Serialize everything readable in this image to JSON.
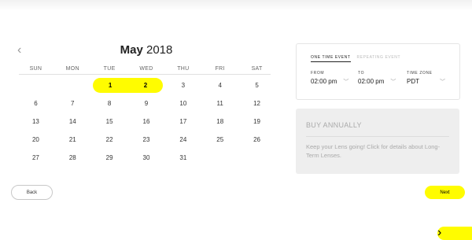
{
  "calendar": {
    "month": "May",
    "year": "2018",
    "prev_symbol": "‹",
    "next_symbol": "›",
    "days_of_week": [
      "SUN",
      "MON",
      "TUE",
      "WED",
      "THU",
      "FRI",
      "SAT"
    ],
    "weeks": [
      [
        "",
        "",
        "1",
        "2",
        "3",
        "4",
        "5"
      ],
      [
        "6",
        "7",
        "8",
        "9",
        "10",
        "11",
        "12"
      ],
      [
        "13",
        "14",
        "15",
        "16",
        "17",
        "18",
        "19"
      ],
      [
        "20",
        "21",
        "22",
        "23",
        "24",
        "25",
        "26"
      ],
      [
        "27",
        "28",
        "29",
        "30",
        "31",
        "",
        ""
      ]
    ],
    "selected_days": [
      "1",
      "2"
    ],
    "highlight_color": "#fffc00"
  },
  "event_panel": {
    "tabs": [
      {
        "label": "ONE TIME EVENT",
        "active": true
      },
      {
        "label": "REPEATING EVENT",
        "active": false
      }
    ],
    "from": {
      "label": "FROM",
      "value": "02:00 pm"
    },
    "to": {
      "label": "TO",
      "value": "02:00 pm"
    },
    "time_zone": {
      "label": "TIME ZONE",
      "value": "PDT"
    },
    "dropdown_icon": "chevron-down-icon"
  },
  "annual": {
    "heading": "BUY ANNUALLY",
    "text": "Keep your Lens going! Click for details about Long-Term Lenses."
  },
  "buttons": {
    "back": "Back",
    "next": "Next"
  }
}
